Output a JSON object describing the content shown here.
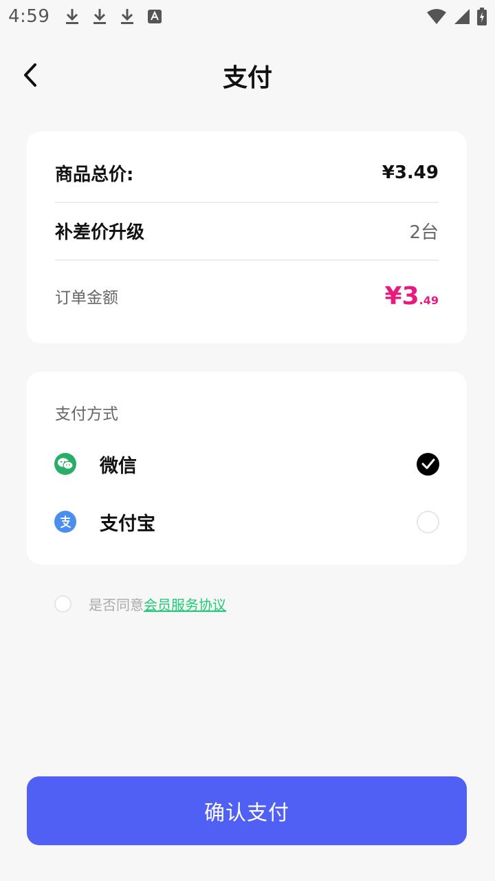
{
  "status_bar": {
    "time": "4:59",
    "left_icons": [
      "download-icon",
      "download-icon",
      "download-icon",
      "text-a-icon"
    ],
    "right_icons": [
      "wifi-icon",
      "signal-icon",
      "battery-charging-icon"
    ]
  },
  "header": {
    "title": "支付",
    "back_icon": "chevron-left-icon"
  },
  "price_card": {
    "goods_total_label": "商品总价:",
    "goods_total_value": "¥3.49",
    "upgrade_label": "补差价升级",
    "upgrade_value": "2台",
    "order_amount_label": "订单金额",
    "order_amount_main": "¥3",
    "order_amount_decimal": ".49",
    "accent_color": "#e8197f"
  },
  "payment": {
    "title": "支付方式",
    "options": [
      {
        "name": "微信",
        "icon": "wechat-icon",
        "selected": true,
        "color": "#2aae67"
      },
      {
        "name": "支付宝",
        "icon": "alipay-icon",
        "selected": false,
        "color": "#4a8ef0"
      }
    ]
  },
  "agreement": {
    "prefix": "是否同意",
    "link": "会员服务协议",
    "checked": false,
    "link_color": "#1fcc74"
  },
  "confirm_button": {
    "label": "确认支付",
    "color": "#5160f4"
  }
}
